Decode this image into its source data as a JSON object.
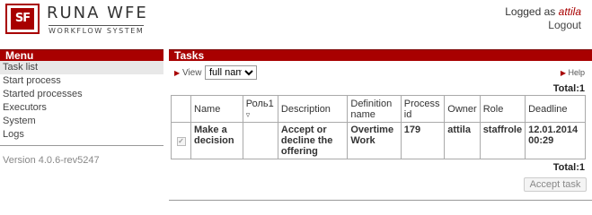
{
  "header": {
    "logo_mark": "SF",
    "logo_title": "RUNA WFE",
    "logo_subtitle": "WORKFLOW SYSTEM",
    "logged_as_label": "Logged as",
    "username": "attila",
    "logout_label": "Logout"
  },
  "menu": {
    "title": "Menu",
    "items": [
      {
        "label": "Task list",
        "active": true
      },
      {
        "label": "Start process"
      },
      {
        "label": "Started processes"
      },
      {
        "label": "Executors"
      },
      {
        "label": "System"
      },
      {
        "label": "Logs"
      }
    ],
    "version": "Version 4.0.6-rev5247"
  },
  "main": {
    "title": "Tasks",
    "view_label": "View",
    "view_select_value": "full name",
    "help_label": "Help",
    "total_label": "Total:1",
    "table": {
      "columns": [
        "Name",
        "Роль1",
        "Description",
        "Definition name",
        "Process id",
        "Owner",
        "Role",
        "Deadline"
      ],
      "rows": [
        {
          "name": "Make a decision",
          "role1": "",
          "description": "Accept or decline the offering",
          "definition": "Overtime Work",
          "process_id": "179",
          "owner": "attila",
          "role": "staffrole",
          "deadline": "12.01.2014 00:29"
        }
      ]
    },
    "accept_button": "Accept task"
  },
  "colors": {
    "accent": "#a80000"
  }
}
